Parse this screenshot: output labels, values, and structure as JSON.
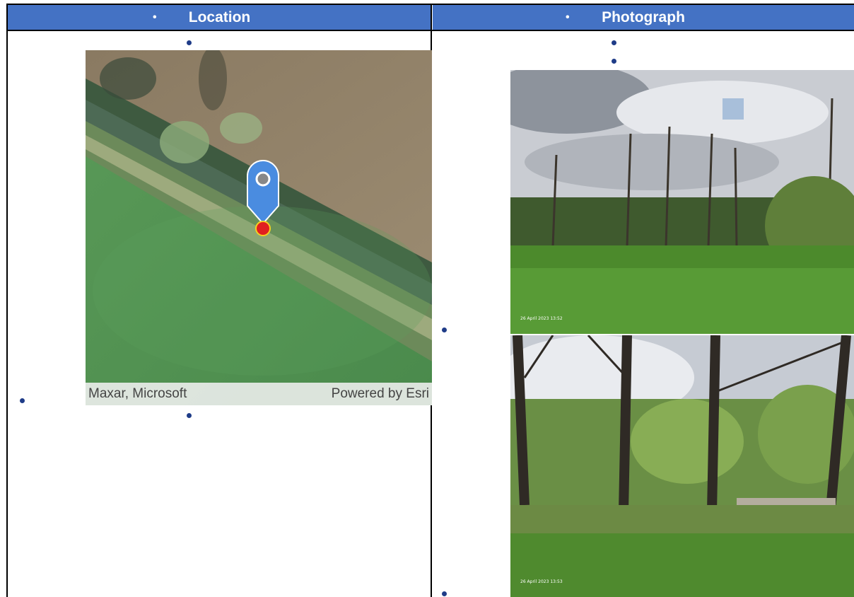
{
  "table": {
    "header_left": "Location",
    "header_right": "Photograph",
    "header_color": "#4472c4"
  },
  "map": {
    "credit_left": "Maxar, Microsoft",
    "credit_right": "Powered by Esri",
    "pin_color": "#4a8ce0",
    "point_color": "#e02020"
  },
  "photos": [
    {
      "timestamp": "26 April 2023 13:52"
    },
    {
      "timestamp": "26 April 2023 13:53"
    }
  ]
}
